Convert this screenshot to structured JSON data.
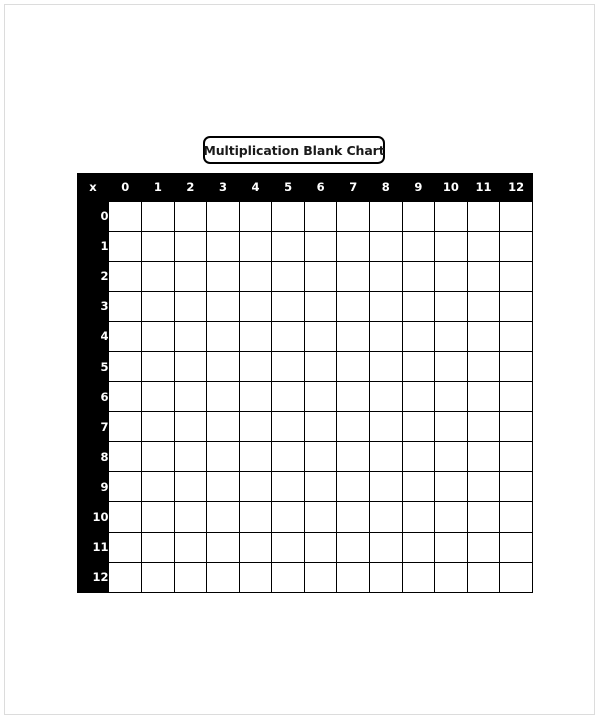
{
  "page": {
    "background_color": "#ffffff",
    "border_color": "#dcdcdc"
  },
  "title": {
    "text": "Multiplication Blank Chart",
    "border_color": "#000000",
    "text_color": "#1a1a1a"
  },
  "chart_data": {
    "type": "table",
    "title": "Multiplication Blank Chart",
    "corner_label": "x",
    "header_background": "#000000",
    "header_text_color": "#ffffff",
    "cell_background": "#ffffff",
    "gridline_color": "#000000",
    "column_headers": [
      "0",
      "1",
      "2",
      "3",
      "4",
      "5",
      "6",
      "7",
      "8",
      "9",
      "10",
      "11",
      "12"
    ],
    "row_headers": [
      "0",
      "1",
      "2",
      "3",
      "4",
      "5",
      "6",
      "7",
      "8",
      "9",
      "10",
      "11",
      "12"
    ],
    "rows": [
      [
        "",
        "",
        "",
        "",
        "",
        "",
        "",
        "",
        "",
        "",
        "",
        "",
        ""
      ],
      [
        "",
        "",
        "",
        "",
        "",
        "",
        "",
        "",
        "",
        "",
        "",
        "",
        ""
      ],
      [
        "",
        "",
        "",
        "",
        "",
        "",
        "",
        "",
        "",
        "",
        "",
        "",
        ""
      ],
      [
        "",
        "",
        "",
        "",
        "",
        "",
        "",
        "",
        "",
        "",
        "",
        "",
        ""
      ],
      [
        "",
        "",
        "",
        "",
        "",
        "",
        "",
        "",
        "",
        "",
        "",
        "",
        ""
      ],
      [
        "",
        "",
        "",
        "",
        "",
        "",
        "",
        "",
        "",
        "",
        "",
        "",
        ""
      ],
      [
        "",
        "",
        "",
        "",
        "",
        "",
        "",
        "",
        "",
        "",
        "",
        "",
        ""
      ],
      [
        "",
        "",
        "",
        "",
        "",
        "",
        "",
        "",
        "",
        "",
        "",
        "",
        ""
      ],
      [
        "",
        "",
        "",
        "",
        "",
        "",
        "",
        "",
        "",
        "",
        "",
        "",
        ""
      ],
      [
        "",
        "",
        "",
        "",
        "",
        "",
        "",
        "",
        "",
        "",
        "",
        "",
        ""
      ],
      [
        "",
        "",
        "",
        "",
        "",
        "",
        "",
        "",
        "",
        "",
        "",
        "",
        ""
      ],
      [
        "",
        "",
        "",
        "",
        "",
        "",
        "",
        "",
        "",
        "",
        "",
        "",
        ""
      ],
      [
        "",
        "",
        "",
        "",
        "",
        "",
        "",
        "",
        "",
        "",
        "",
        "",
        ""
      ]
    ]
  }
}
